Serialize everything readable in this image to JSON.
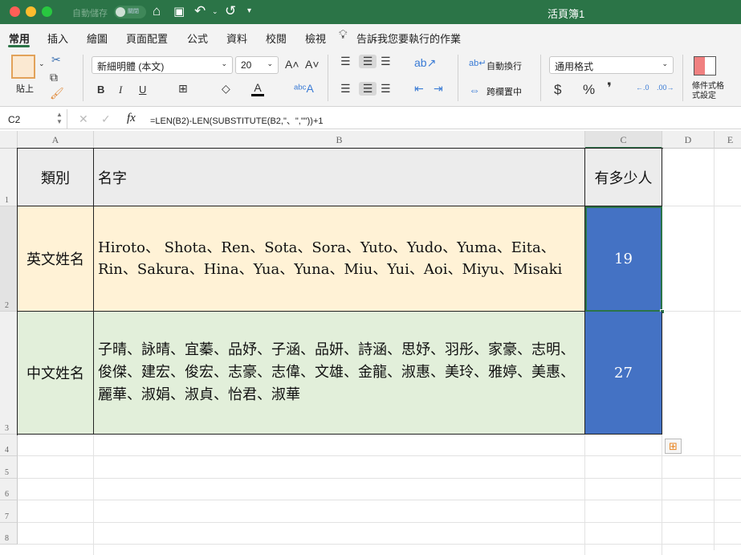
{
  "titlebar": {
    "autosave": "自動儲存",
    "toggle": "關閉",
    "title": "活頁簿1"
  },
  "tabs": [
    "常用",
    "插入",
    "繪圖",
    "頁面配置",
    "公式",
    "資料",
    "校閱",
    "檢視"
  ],
  "tell_me": "告訴我您要執行的作業",
  "ribbon": {
    "paste": "貼上",
    "font": "新細明體 (本文)",
    "size": "20",
    "wrap": "自動換行",
    "merge": "跨欄置中",
    "number_format": "通用格式",
    "cond_format": "條件式格式設定",
    "bold": "B",
    "italic": "I",
    "underline": "U",
    "dollar": "$",
    "percent": "%",
    "comma": "❜"
  },
  "formula": {
    "cell_ref": "C2",
    "fx": "fx",
    "value": "=LEN(B2)-LEN(SUBSTITUTE(B2,\"、\",\"\"))+1"
  },
  "columns": [
    "A",
    "B",
    "C",
    "D",
    "E"
  ],
  "rows": [
    "1",
    "2",
    "3",
    "4",
    "5",
    "6",
    "7",
    "8"
  ],
  "table": {
    "header": {
      "a": "類別",
      "b": "名字",
      "c": "有多少人"
    },
    "row2": {
      "a": "英文姓名",
      "b": "Hiroto、 Shota、Ren、Sota、Sora、Yuto、Yudo、Yuma、Eita、Rin、Sakura、Hina、Yua、Yuna、Miu、Yui、Aoi、Miyu、Misaki",
      "c": "19"
    },
    "row3": {
      "a": "中文姓名",
      "b": "子晴、詠晴、宜蓁、品妤、子涵、品妍、詩涵、思妤、羽彤、家豪、志明、俊傑、建宏、俊宏、志豪、志偉、文雄、金龍、淑惠、美玲、雅婷、美惠、麗華、淑娟、淑貞、怡君、淑華",
      "c": "27"
    }
  },
  "colors": {
    "title": "#2b7447",
    "row2_fill": "#fff2d6",
    "row3_fill": "#e2efda",
    "count_fill": "#4472c4"
  }
}
